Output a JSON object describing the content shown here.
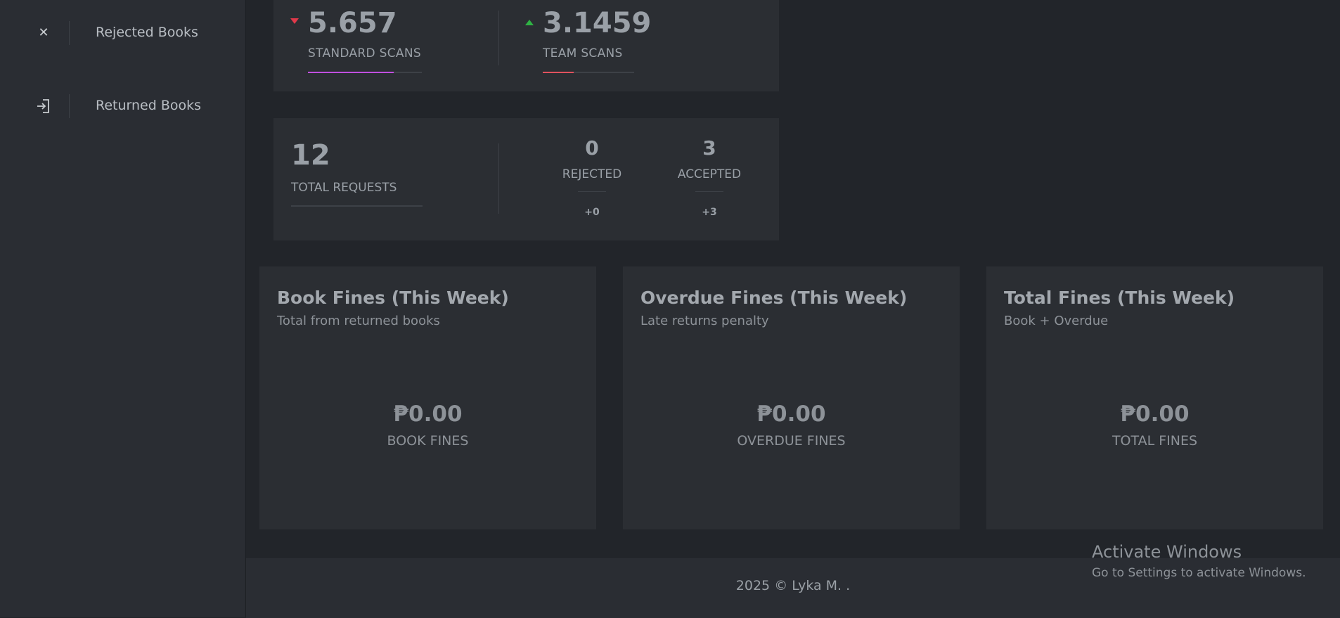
{
  "sidebar": {
    "items": [
      {
        "icon": "close-icon",
        "label": "Rejected Books"
      },
      {
        "icon": "sign-in-icon",
        "label": "Returned Books"
      }
    ]
  },
  "scans": {
    "standard": {
      "value": "5.657",
      "label": "STANDARD SCANS",
      "trend": "down",
      "progress_percent": 75,
      "bar_color": "#c04fe0"
    },
    "team": {
      "value": "3.1459",
      "label": "TEAM SCANS",
      "trend": "up",
      "progress_percent": 34,
      "bar_color": "#e0525e"
    }
  },
  "requests": {
    "total": {
      "value": "12",
      "label": "TOTAL REQUESTS"
    },
    "rejected": {
      "value": "0",
      "label": "REJECTED",
      "delta": "+0"
    },
    "accepted": {
      "value": "3",
      "label": "ACCEPTED",
      "delta": "+3"
    }
  },
  "fines": [
    {
      "title": "Book Fines (This Week)",
      "subtitle": "Total from returned books",
      "amount": "₱0.00",
      "label": "BOOK FINES"
    },
    {
      "title": "Overdue Fines (This Week)",
      "subtitle": "Late returns penalty",
      "amount": "₱0.00",
      "label": "OVERDUE FINES"
    },
    {
      "title": "Total Fines (This Week)",
      "subtitle": "Book + Overdue",
      "amount": "₱0.00",
      "label": "TOTAL FINES"
    }
  ],
  "footer": {
    "text": "2025 © Lyka M. ."
  },
  "watermark": {
    "title": "Activate Windows",
    "subtitle": "Go to Settings to activate Windows."
  },
  "colors": {
    "trend_down": "#e0394a",
    "trend_up": "#2fb344"
  }
}
